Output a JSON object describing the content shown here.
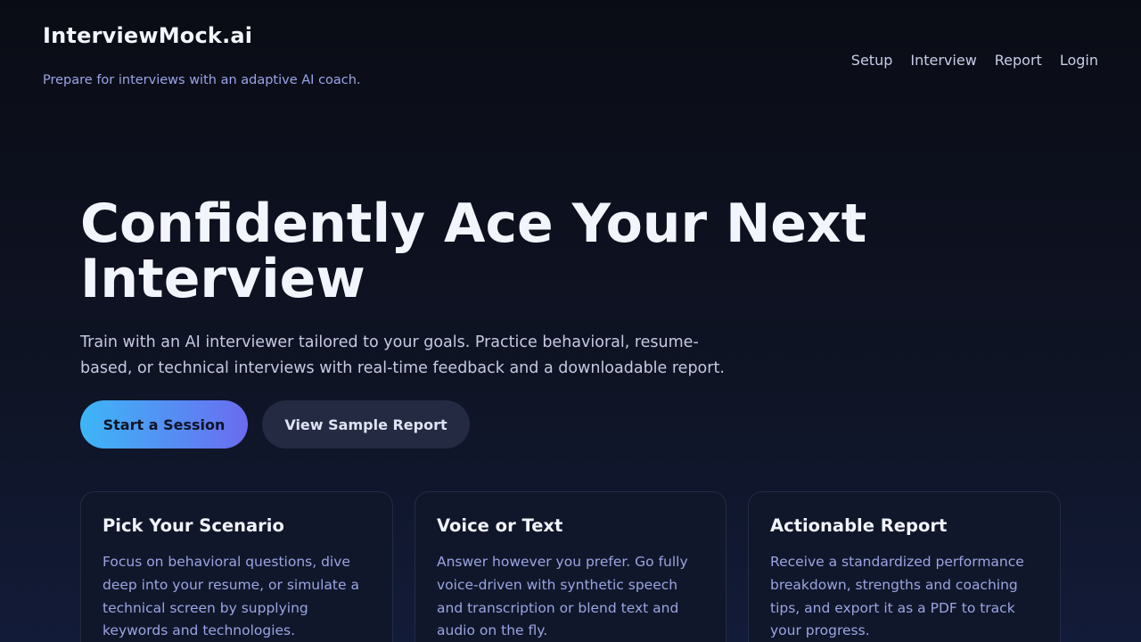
{
  "header": {
    "brand": "InterviewMock.ai",
    "tagline": "Prepare for interviews with an adaptive AI coach.",
    "nav": [
      "Setup",
      "Interview",
      "Report",
      "Login"
    ]
  },
  "hero": {
    "title": "Confidently Ace Your Next Interview",
    "subtitle": "Train with an AI interviewer tailored to your goals. Practice behavioral, resume-based, or technical interviews with real-time feedback and a downloadable report.",
    "primary_cta": "Start a Session",
    "secondary_cta": "View Sample Report"
  },
  "features": [
    {
      "title": "Pick Your Scenario",
      "body": "Focus on behavioral questions, dive deep into your resume, or simulate a technical screen by supplying keywords and technologies."
    },
    {
      "title": "Voice or Text",
      "body": "Answer however you prefer. Go fully voice-driven with synthetic speech and transcription or blend text and audio on the fly."
    },
    {
      "title": "Actionable Report",
      "body": "Receive a standardized performance breakdown, strengths and coaching tips, and export it as a PDF to track your progress."
    }
  ],
  "colors": {
    "accent_start": "#3db6f7",
    "accent_end": "#6a6cf0",
    "background": "#0f1425"
  }
}
